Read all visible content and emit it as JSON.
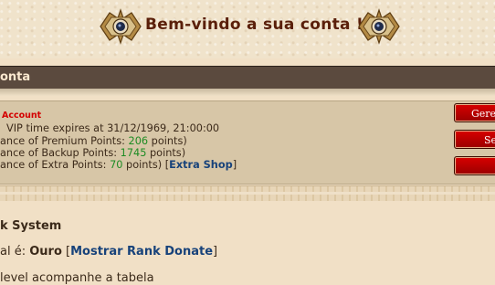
{
  "header": {
    "title": "Bem-vindo a sua conta !"
  },
  "section": {
    "title": "onta"
  },
  "account": {
    "label": "Account",
    "vip_line": "VIP time expires at 31/12/1969, 21:00:00",
    "premium_prefix": "ance of Premium Points: ",
    "premium_value": "206",
    "premium_suffix": " points)",
    "backup_prefix": "ance of Backup Points: ",
    "backup_value": "1745",
    "backup_suffix": " points)",
    "extra_prefix": "ance of Extra Points: ",
    "extra_value": "70",
    "extra_suffix": " points) [",
    "extra_shop": "Extra Shop",
    "extra_close": "]"
  },
  "buttons": [
    {
      "label": "Geren"
    },
    {
      "label": "Se"
    },
    {
      "label": ""
    }
  ],
  "rank": {
    "title": "k System",
    "level_prefix": "al é: ",
    "level_value": "Ouro",
    "open_bracket": " [",
    "link": "Mostrar Rank Donate",
    "close_bracket": "]",
    "cut_text": "level acompanhe a tabela"
  },
  "colors": {
    "accent": "#d40000",
    "points": "#1e8c24",
    "link": "#17427a",
    "bar": "#5b4a3e"
  }
}
